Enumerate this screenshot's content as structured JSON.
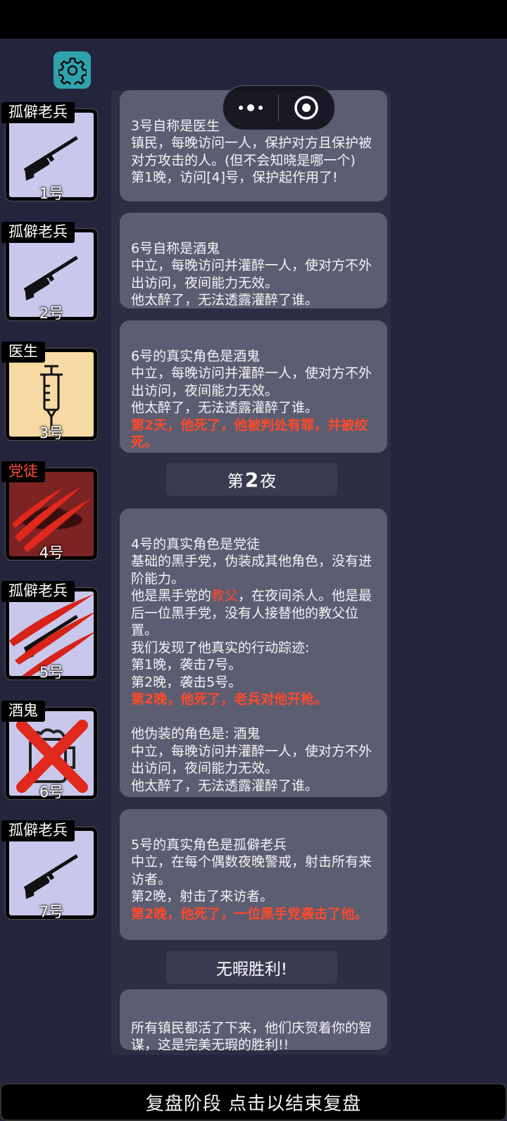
{
  "status_bar": {},
  "capsule": {
    "more_icon": "more-dots-icon",
    "close_icon": "target-circle-icon"
  },
  "settings": {
    "icon": "gear-icon",
    "color": "#2fa3ad"
  },
  "players": [
    {
      "role": "孤僻老兵",
      "number": "1号",
      "art": "rifle",
      "bg": "#c9c8ec"
    },
    {
      "role": "孤僻老兵",
      "number": "2号",
      "art": "rifle",
      "bg": "#c9c8ec"
    },
    {
      "role": "医生",
      "number": "3号",
      "art": "syringe",
      "bg": "#f6d9a3"
    },
    {
      "role": "党徒",
      "number": "4号",
      "art": "slash-hat",
      "bg": "#7c2324"
    },
    {
      "role": "孤僻老兵",
      "number": "5号",
      "art": "rifle-slashed",
      "bg": "#c9c8ec"
    },
    {
      "role": "酒鬼",
      "number": "6号",
      "art": "beer-crossed",
      "bg": "#c9c8ec"
    },
    {
      "role": "孤僻老兵",
      "number": "7号",
      "art": "rifle",
      "bg": "#c9c8ec"
    }
  ],
  "log": {
    "msg1": "3号自称是医生\n镇民，每晚访问一人，保护对方且保护被对方攻击的人。(但不会知晓是哪一个)\n第1晚，访问[4]号，保护起作用了!",
    "msg2": "6号自称是酒鬼\n中立，每晚访问并灌醉一人，使对方不外出访问，夜间能力无效。\n他太醉了，无法透露灌醉了谁。",
    "msg3_text": "6号的真实角色是酒鬼\n中立，每晚访问并灌醉一人，使对方不外出访问，夜间能力无效。\n他太醉了，无法透露灌醉了谁。",
    "msg3_red": "第2天，他死了，他被判处有罪，并被绞死。",
    "night_prefix": "第",
    "night_number": "2",
    "night_suffix": "夜",
    "msg4_a": "4号的真实角色是党徒\n基础的黑手党，伪装成其他角色，没有进阶能力。\n他是黑手党的",
    "msg4_hl": "教父",
    "msg4_b": "，在夜间杀人。他是最后一位黑手党，没有人接替他的教父位置。\n我们发现了他真实的行动踪迹:\n第1晚，袭击7号。\n第2晚，袭击5号。",
    "msg4_red": "第2晚，他死了，老兵对他开枪。",
    "msg4_c": "\n他伪装的角色是: 酒鬼\n中立，每晚访问并灌醉一人，使对方不外出访问，夜间能力无效。\n他太醉了，无法透露灌醉了谁。",
    "msg5_text": "5号的真实角色是孤僻老兵\n中立，在每个偶数夜晚警戒，射击所有来访者。\n第2晚，射击了来访者。",
    "msg5_red": "第2晚，他死了，一位黑手党袭击了他。",
    "victory_title": "无暇胜利!",
    "msg6": "所有镇民都活了下来，他们庆贺着你的智谋，这是完美无瑕的胜利!!"
  },
  "bottom_bar": {
    "label": "复盘阶段 点击以结束复盘"
  },
  "colors": {
    "death_text": "#ff4a2a",
    "panel": "#2d2e44",
    "bubble": "#5c5d71"
  }
}
